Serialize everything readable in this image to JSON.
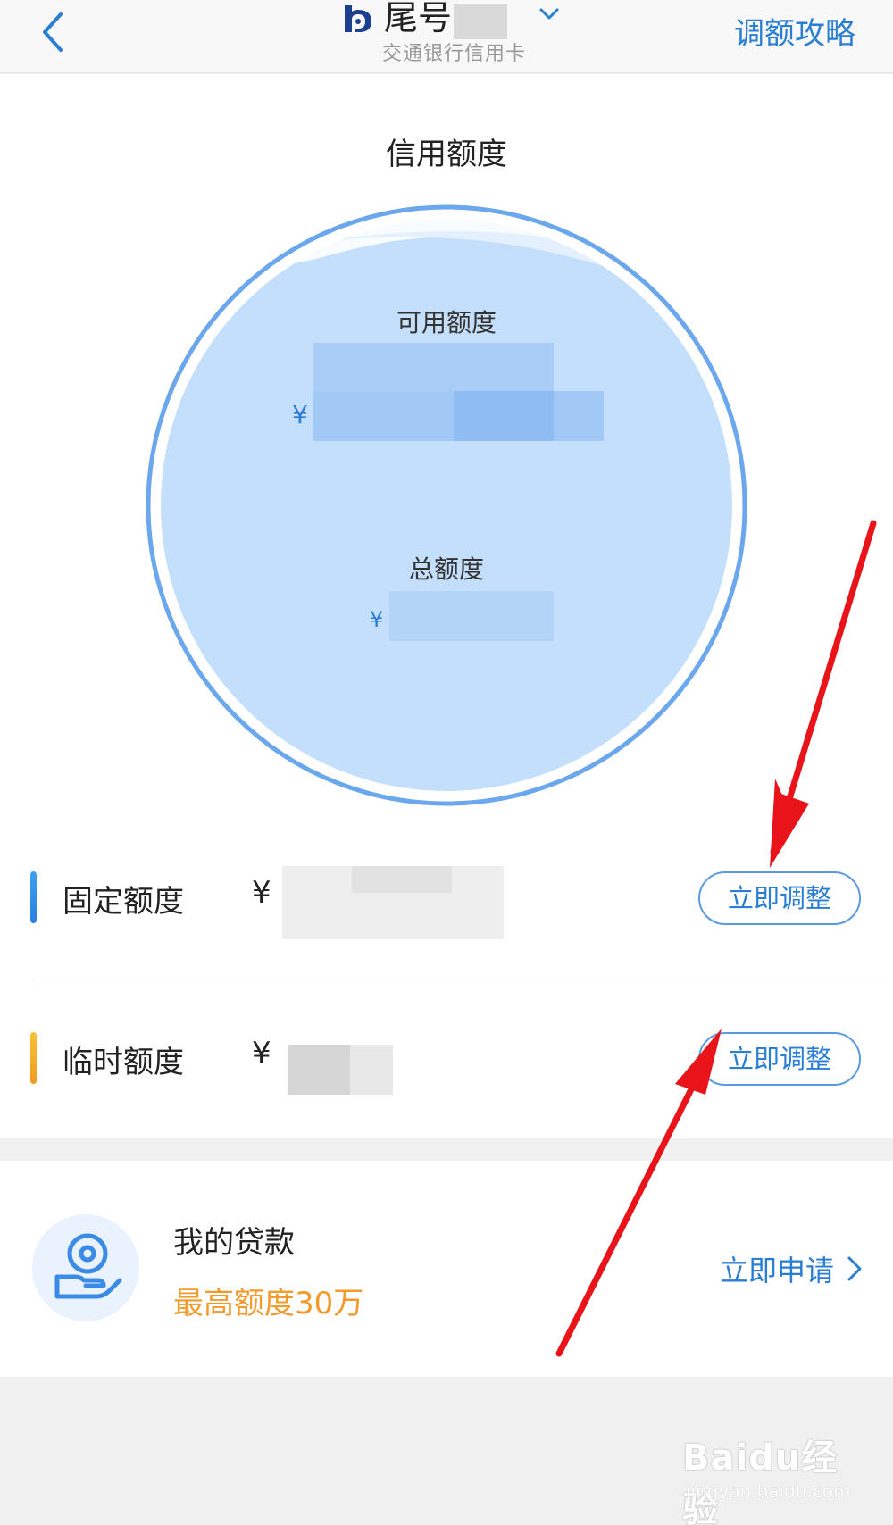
{
  "header": {
    "card_title": "尾号",
    "bank_name": "交通银行信用卡",
    "strategy_label": "调额攻略"
  },
  "main": {
    "section_title": "信用额度",
    "available_label": "可用额度",
    "total_label": "总额度",
    "currency_symbol": "¥"
  },
  "rows": {
    "fixed": {
      "label": "固定额度",
      "currency": "¥",
      "button": "立即调整",
      "color": "#2f86e6"
    },
    "temporary": {
      "label": "临时额度",
      "currency": "¥",
      "button": "立即调整",
      "color": "#f5a623"
    }
  },
  "loan": {
    "title": "我的贷款",
    "subtitle": "最高额度30万",
    "apply_label": "立即申请"
  },
  "watermark": {
    "brand": "Baidu经验",
    "url": "jingyan.baidu.com"
  },
  "colors": {
    "accent": "#2a7ed3",
    "orange": "#f39a2b",
    "arrow": "#e8141a"
  }
}
